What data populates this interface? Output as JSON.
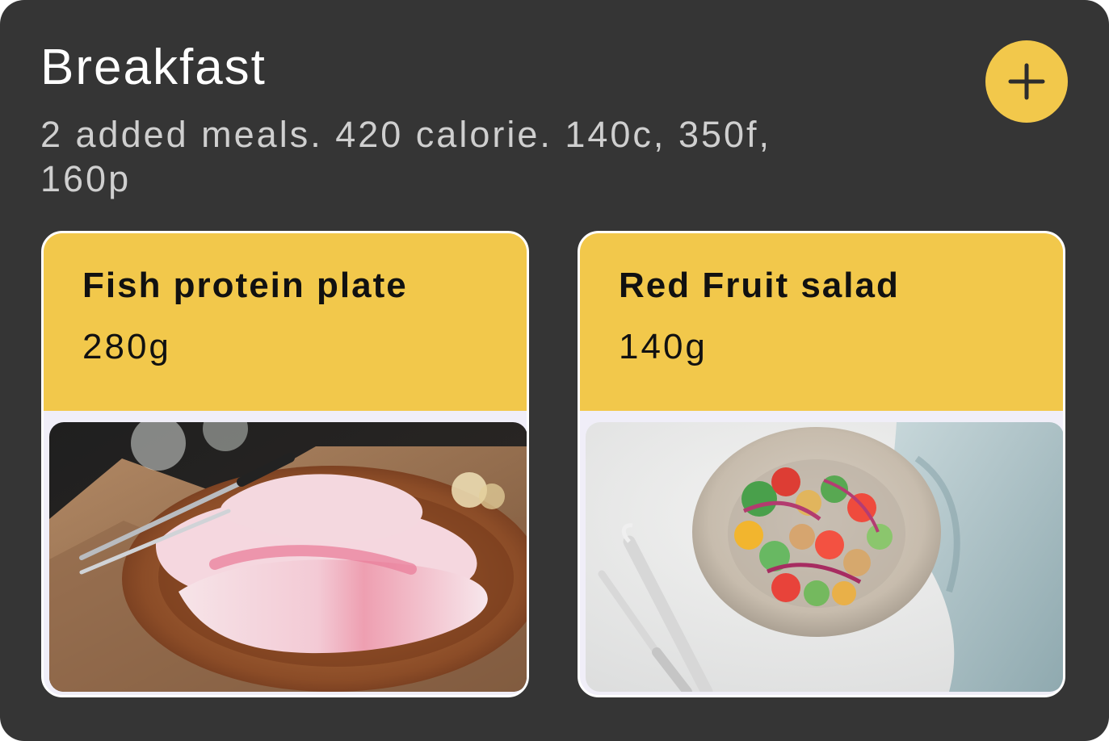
{
  "section": {
    "title": "Breakfast",
    "summary": "2 added meals. 420 calorie. 140c, 350f, 160p",
    "add_icon": "plus-icon"
  },
  "meals": [
    {
      "name": "Fish protein plate",
      "weight": "280g",
      "image": "fish-fillet-photo"
    },
    {
      "name": "Red Fruit salad",
      "weight": "140g",
      "image": "salad-bowl-photo"
    }
  ],
  "colors": {
    "background": "#353535",
    "accent": "#f2c84b",
    "card": "#f0eef8",
    "text_dark": "#111111",
    "text_light": "#ffffff",
    "text_muted": "#cfcfcf"
  }
}
